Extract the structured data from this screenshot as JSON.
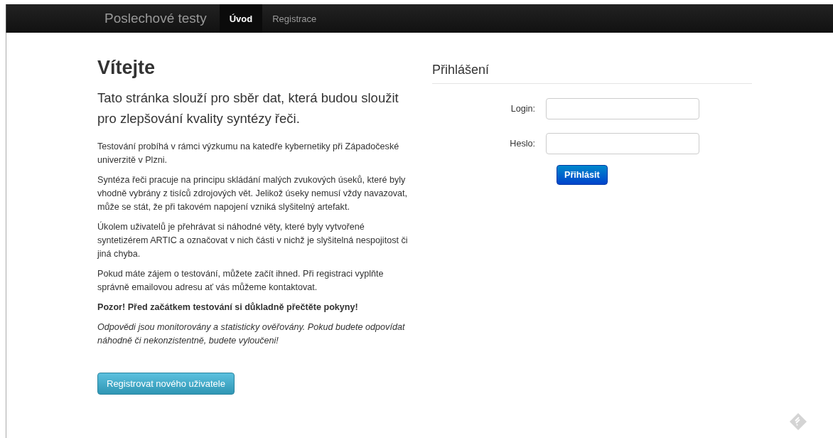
{
  "navbar": {
    "brand": "Poslechové testy",
    "items": [
      {
        "label": "Úvod",
        "selected": true
      },
      {
        "label": "Registrace",
        "selected": false
      }
    ]
  },
  "welcome": {
    "title": "Vítejte",
    "lead": "Tato stránka slouží pro sběr dat, která budou sloužit pro zlepšování kvality syntézy řeči.",
    "paragraphs": [
      {
        "kind": "normal",
        "text": "Testování probíhá v rámci výzkumu na katedře kybernetiky při Západočeské univerzitě v Plzni."
      },
      {
        "kind": "normal",
        "text": "Syntéza řeči pracuje na principu skládání malých zvukových úseků, které byly vhodně vybrány z tisíců zdrojových vět. Jelikož úseky nemusí vždy navazovat, může se stát, že při takovém napojení vzniká slyšitelný artefakt."
      },
      {
        "kind": "normal",
        "text": "Úkolem uživatelů je přehrávat si náhodné věty, které byly vytvořené syntetizérem ARTIC a označovat v nich části v nichž je slyšitelná nespojitost či jiná chyba."
      },
      {
        "kind": "normal",
        "text": "Pokud máte zájem o testování, můžete začít ihned. Při registraci vyplňte správně emailovou adresu ať vás můžeme kontaktovat."
      },
      {
        "kind": "warning",
        "text": "Pozor! Před začátkem testování si důkladně přečtěte pokyny!"
      },
      {
        "kind": "note",
        "text": "Odpovědi jsou monitorovány a statisticky ověřovány. Pokud budete odpovídat náhodně či nekonzistentně, budete vyloučeni!"
      }
    ],
    "register_button": "Registrovat nového uživatele"
  },
  "login": {
    "title": "Přihlášení",
    "fields": [
      {
        "label": "Login:"
      },
      {
        "label": "Heslo:"
      }
    ],
    "submit_button": "Přihlásit"
  }
}
